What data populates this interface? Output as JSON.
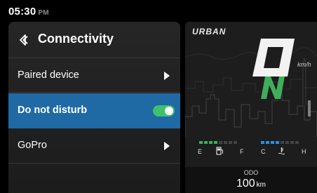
{
  "status_bar": {
    "time": "05:30",
    "ampm": "PM"
  },
  "menu": {
    "title": "Connectivity",
    "items": [
      {
        "label": "Paired device"
      },
      {
        "label": "Do not disturb",
        "toggle": "on"
      },
      {
        "label": "GoPro"
      }
    ]
  },
  "cluster": {
    "brand": "URBAN",
    "speed_display": "0",
    "speed_unit": "km/h",
    "gear": "N",
    "fuel": {
      "empty_label": "E",
      "full_label": "F",
      "level_segments": 4,
      "total_segments": 8
    },
    "temperature": {
      "cold_label": "C",
      "hot_label": "H",
      "level_segments": 4,
      "total_segments": 8
    },
    "odo_label": "ODO",
    "odo_value": "100",
    "odo_unit": "km"
  },
  "colors": {
    "selected_row": "#1f6aa5",
    "toggle_on": "#3fc26b",
    "gear": "#3fae5a",
    "fuel_bar": "#3fae5a",
    "temp_bar": "#2f8fe0"
  }
}
